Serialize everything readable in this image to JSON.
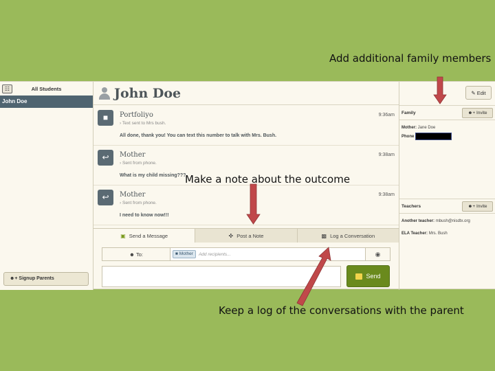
{
  "callouts": {
    "family": "Add additional family members",
    "note": "Make a note about the outcome",
    "log": "Keep a log of the conversations with the parent"
  },
  "sidebar": {
    "title": "All Students",
    "students": [
      "John Doe"
    ],
    "signup_label": "Signup Parents"
  },
  "header": {
    "student_name": "John Doe",
    "edit_label": "Edit"
  },
  "messages": [
    {
      "sender": "Portfoliyo",
      "meta": "Text sent to Mrs bush.",
      "body": "All done, thank you! You can text this number to talk with Mrs. Bush.",
      "time": "9:36am"
    },
    {
      "sender": "Mother",
      "meta": "Sent from phone.",
      "body": "What is my child missing???",
      "time": "9:38am"
    },
    {
      "sender": "Mother",
      "meta": "Sent from phone.",
      "body": "I need to know now!!!",
      "time": "9:38am"
    }
  ],
  "tabs": [
    "Send a Message",
    "Post a Note",
    "Log a Conversation"
  ],
  "compose": {
    "to_label": "To:",
    "recipient_chip": "Mother",
    "recipients_placeholder": "Add recipients...",
    "send_label": "Send"
  },
  "family": {
    "label": "Family",
    "invite_label": "Invite",
    "mother_label": "Mother:",
    "mother_value": "Jane Doe",
    "phone_label": "Phone"
  },
  "teachers": {
    "label": "Teachers",
    "invite_label": "Invite",
    "rows": [
      {
        "label": "Another teacher:",
        "value": "mbush@nisdtx.org"
      },
      {
        "label": "ELA Teacher:",
        "value": "Mrs. Bush"
      }
    ]
  },
  "colors": {
    "background": "#9aba5a",
    "accent": "#6a8a1d",
    "arrow": "#c0484a"
  }
}
